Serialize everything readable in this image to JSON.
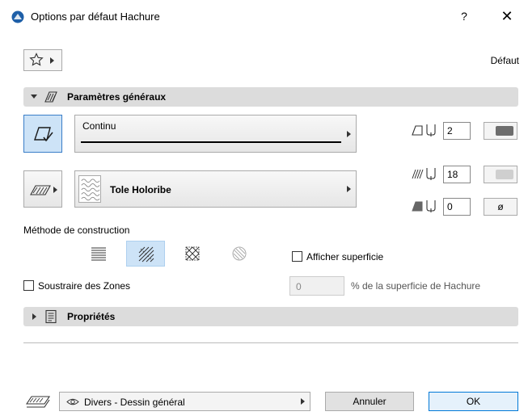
{
  "window": {
    "title": "Options par défaut Hachure",
    "help": "?",
    "close": "✕"
  },
  "favorites": {
    "default_label": "Défaut"
  },
  "general": {
    "title": "Paramètres généraux",
    "line_type": "Continu",
    "contour_pen": "2",
    "fill_pen": "18",
    "background_pen": "0",
    "background_symbol": "ø",
    "fill_pattern": "Tole Holoribe",
    "fill_swatch_color": "#6d6d6d",
    "fill_swatch_color_light": "#cfcfcf"
  },
  "construction": {
    "label": "Méthode de construction",
    "methods": [
      "lines",
      "hatch",
      "cross",
      "round"
    ],
    "selected": "hatch",
    "show_area_label": "Afficher superficie",
    "show_area_checked": false,
    "subtract_zones_label": "Soustraire des Zones",
    "subtract_zones_checked": false,
    "percent_value": "0",
    "percent_label": "% de la superficie de Hachure"
  },
  "properties": {
    "title": "Propriétés"
  },
  "footer": {
    "layer": "Divers - Dessin général",
    "cancel_label": "Annuler",
    "ok_label": "OK"
  },
  "colors": {
    "selected_bg": "#cde3f7",
    "selected_border": "#3a7ec8",
    "ok_border": "#0078d7",
    "header_bg": "#dcdcdc",
    "app_icon": "#1e5fa8"
  }
}
